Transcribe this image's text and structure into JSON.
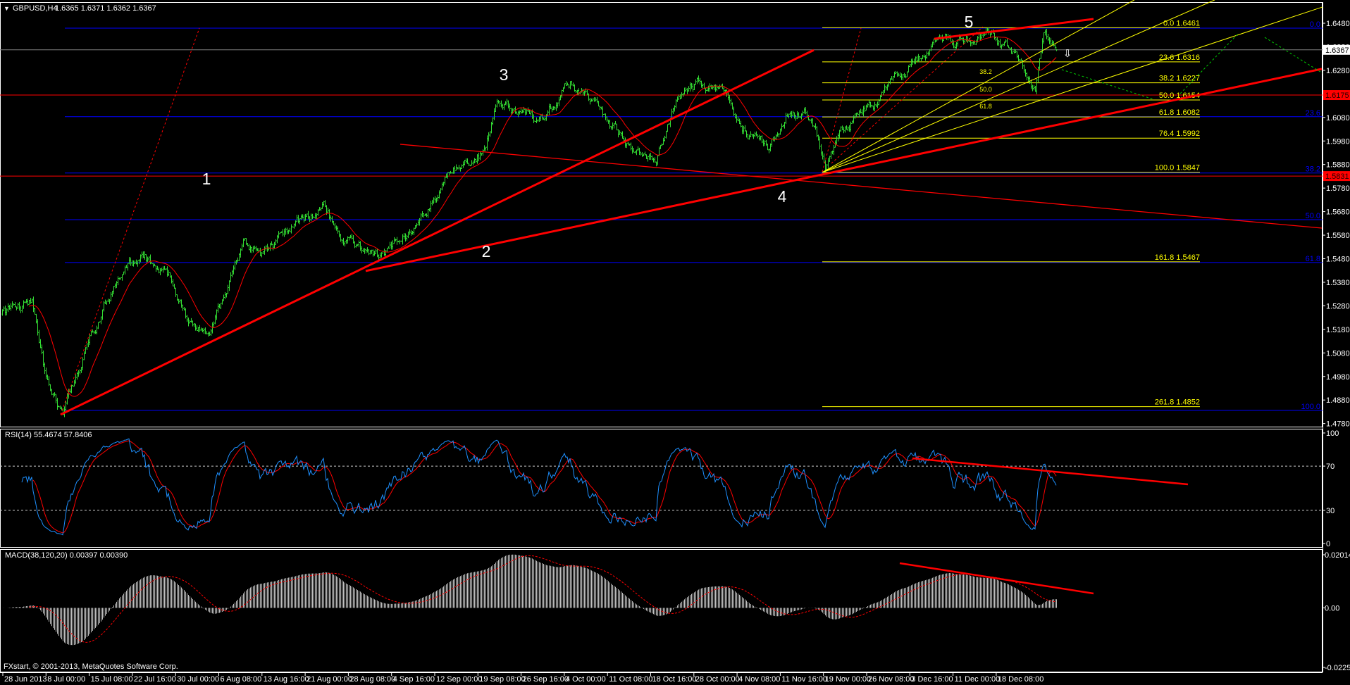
{
  "header": {
    "collapse_icon": "triangle-down-icon",
    "symbol": "GBPUSD,H4",
    "ohlc": "1.6365 1.6371 1.6362 1.6367"
  },
  "copyright": "FXstart, © 2001-2013, MetaQuotes Software Corp.",
  "colors": {
    "bars": "#33dd33",
    "ma": "#ff0000",
    "trend": "#ff0000",
    "fib": "#ffff00",
    "fib_blue": "#0000ff",
    "rsi": "#1e90ff",
    "macd_hist": "#c0c0c0",
    "grid_text": "#ffffff",
    "projection": "#00cc00"
  },
  "chart_data": {
    "type": "ohlc-bar",
    "symbol": "GBPUSD",
    "timeframe": "H4",
    "last_bar": {
      "open": 1.6365,
      "high": 1.6371,
      "low": 1.6362,
      "close": 1.6367
    },
    "bars_count": 749,
    "price_axis": {
      "min": 1.478,
      "max": 1.648,
      "ticks": [
        "1.6480",
        "1.6380",
        "1.6280",
        "1.6180",
        "1.6080",
        "1.5980",
        "1.5880",
        "1.5780",
        "1.5680",
        "1.5580",
        "1.5480",
        "1.5380",
        "1.5280",
        "1.5180",
        "1.5080",
        "1.4980",
        "1.4880",
        "1.4780"
      ]
    },
    "price_tags": [
      {
        "value": "1.6367",
        "price": 1.6367,
        "kind": "bid"
      },
      {
        "value": "1.6175",
        "price": 1.6175,
        "kind": "level"
      },
      {
        "value": "1.5831",
        "price": 1.5831,
        "kind": "level"
      }
    ],
    "time_labels": [
      "28 Jun 2013",
      "8 Jul 00:00",
      "15 Jul 08:00",
      "22 Jul 16:00",
      "30 Jul 00:00",
      "6 Aug 08:00",
      "13 Aug 16:00",
      "21 Aug 00:00",
      "28 Aug 08:00",
      "4 Sep 16:00",
      "12 Sep 00:00",
      "19 Sep 08:00",
      "26 Sep 16:00",
      "4 Oct 00:00",
      "11 Oct 08:00",
      "18 Oct 16:00",
      "28 Oct 00:00",
      "4 Nov 08:00",
      "11 Nov 16:00",
      "19 Nov 00:00",
      "26 Nov 08:00",
      "3 Dec 16:00",
      "11 Dec 00:00",
      "18 Dec 08:00"
    ],
    "price_keypoints": [
      [
        0,
        1.5245
      ],
      [
        3,
        1.5245
      ],
      [
        21,
        1.53
      ],
      [
        31,
        1.4971
      ],
      [
        43,
        1.4825
      ],
      [
        61,
        1.5118
      ],
      [
        79,
        1.5373
      ],
      [
        101,
        1.5483
      ],
      [
        119,
        1.5391
      ],
      [
        131,
        1.5227
      ],
      [
        147,
        1.5136
      ],
      [
        171,
        1.5519
      ],
      [
        183,
        1.5483
      ],
      [
        208,
        1.5629
      ],
      [
        229,
        1.5684
      ],
      [
        238,
        1.5592
      ],
      [
        257,
        1.5501
      ],
      [
        269,
        1.5483
      ],
      [
        287,
        1.5592
      ],
      [
        306,
        1.5739
      ],
      [
        324,
        1.5885
      ],
      [
        342,
        1.5958
      ],
      [
        351,
        1.614
      ],
      [
        360,
        1.6104
      ],
      [
        379,
        1.6067
      ],
      [
        403,
        1.6232
      ],
      [
        422,
        1.6122
      ],
      [
        434,
        1.6031
      ],
      [
        446,
        1.5939
      ],
      [
        464,
        1.5921
      ],
      [
        480,
        1.6177
      ],
      [
        495,
        1.6232
      ],
      [
        510,
        1.6177
      ],
      [
        525,
        1.6067
      ],
      [
        544,
        1.5939
      ],
      [
        559,
        1.6122
      ],
      [
        571,
        1.6104
      ],
      [
        584,
        1.5903
      ],
      [
        593,
        1.5994
      ],
      [
        611,
        1.6122
      ],
      [
        635,
        1.6213
      ],
      [
        654,
        1.636
      ],
      [
        666,
        1.6414
      ],
      [
        690,
        1.6396
      ],
      [
        703,
        1.644
      ],
      [
        721,
        1.6341
      ],
      [
        733,
        1.6232
      ],
      [
        739,
        1.6433
      ],
      [
        748,
        1.6367
      ]
    ],
    "moving_average_period": 20,
    "horizontal_levels": [
      {
        "price": 1.6175,
        "color": "#ff0000"
      },
      {
        "price": 1.5831,
        "color": "#ff0000"
      },
      {
        "price": 1.6367,
        "color": "#808080"
      }
    ],
    "fib_blue": [
      {
        "label": "0.0",
        "price": 1.6459
      },
      {
        "label": "23.6",
        "price": 1.6083
      },
      {
        "label": "38.2",
        "price": 1.5844
      },
      {
        "label": "50.0",
        "price": 1.5646
      },
      {
        "label": "61.8",
        "price": 1.5464
      },
      {
        "label": "100.0",
        "price": 1.4836
      }
    ],
    "fib_retracement": {
      "from_bar": 582,
      "to_bar": 850,
      "levels": [
        {
          "ratio": "0.0",
          "price": "1.6461"
        },
        {
          "ratio": "23.6",
          "price": "1.6316"
        },
        {
          "ratio": "38.2",
          "price": "1.6227"
        },
        {
          "ratio": "50.0",
          "price": "1.6154"
        },
        {
          "ratio": "61.8",
          "price": "1.6082"
        },
        {
          "ratio": "76.4",
          "price": "1.5992"
        },
        {
          "ratio": "100.0",
          "price": "1.5847"
        },
        {
          "ratio": "161.8",
          "price": "1.5467"
        },
        {
          "ratio": "261.8",
          "price": "1.4852"
        }
      ]
    },
    "fib_fan": {
      "origin": [
        582,
        1.5847
      ],
      "ends": [
        [
          803.5,
          1.6579
        ],
        [
          860.5,
          1.6579
        ],
        [
          937,
          1.6549
        ]
      ],
      "labels": [
        {
          "text": "38.2",
          "bar": 698,
          "price": 1.6265
        },
        {
          "text": "50.0",
          "bar": 698,
          "price": 1.619
        },
        {
          "text": "61.8",
          "bar": 698,
          "price": 1.6118
        }
      ]
    },
    "trendlines": [
      {
        "from": [
          41.5,
          1.4818
        ],
        "to": [
          576,
          1.6366
        ],
        "style": "thick"
      },
      {
        "from": [
          258,
          1.5428
        ],
        "to": [
          936.5,
          1.6286
        ],
        "style": "thick"
      },
      {
        "from": [
          282.5,
          1.5966
        ],
        "to": [
          936.5,
          1.561
        ],
        "style": "thin"
      },
      {
        "from": [
          661.5,
          1.6414
        ],
        "to": [
          774.5,
          1.6498
        ],
        "style": "thick"
      },
      {
        "from": [
          41.5,
          1.4818
        ],
        "to": [
          140,
          1.6459
        ],
        "style": "dotted"
      },
      {
        "from": [
          582,
          1.5849
        ],
        "to": [
          609.5,
          1.6459
        ],
        "style": "dotted"
      },
      {
        "from": [
          588.5,
          1.5885
        ],
        "to": [
          696,
          1.6465
        ],
        "style": "dotted"
      }
    ],
    "projections": [
      {
        "from": [
          752,
          1.6283
        ],
        "to": [
          817,
          1.6157
        ]
      },
      {
        "from": [
          836,
          1.6181
        ],
        "to": [
          877,
          1.6435
        ]
      },
      {
        "from": [
          896,
          1.642
        ],
        "to": [
          937,
          1.6268
        ]
      }
    ],
    "sell_arrow": {
      "icon": "arrow-down-icon",
      "glyph": "⇩",
      "bar": 756,
      "price": 1.6351
    },
    "wave_labels": [
      {
        "label": "1",
        "bar": 145,
        "price": 1.5819
      },
      {
        "label": "2",
        "bar": 343.5,
        "price": 1.5511
      },
      {
        "label": "3",
        "bar": 356,
        "price": 1.6262
      },
      {
        "label": "4",
        "bar": 553.5,
        "price": 1.5745
      },
      {
        "label": "5",
        "bar": 686,
        "price": 1.6486
      }
    ]
  },
  "rsi": {
    "title": "RSI(14) 55.4674 57.8406",
    "period": 14,
    "signal_period": 9,
    "levels": [
      70,
      30
    ],
    "ticks": [
      {
        "label": "100",
        "value": 100
      },
      {
        "label": "70",
        "value": 70
      },
      {
        "label": "30",
        "value": 30
      },
      {
        "label": "0",
        "value": 0
      }
    ],
    "trendline": {
      "from": [
        646,
        77.1
      ],
      "to": [
        841.5,
        53.5
      ]
    }
  },
  "macd": {
    "title": "MACD(38,120,20) 0.00397 0.00390",
    "fast": 38,
    "slow": 120,
    "signal": 20,
    "range": [
      -0.02256,
      0.02014
    ],
    "ticks": [
      {
        "label": "0.02014",
        "value": 0.02014
      },
      {
        "label": "0.00",
        "value": 0
      },
      {
        "label": "-0.02256",
        "value": -0.02256
      }
    ],
    "trendline": {
      "from": [
        637,
        0.01694
      ],
      "to": [
        774.5,
        0.00546
      ]
    }
  }
}
